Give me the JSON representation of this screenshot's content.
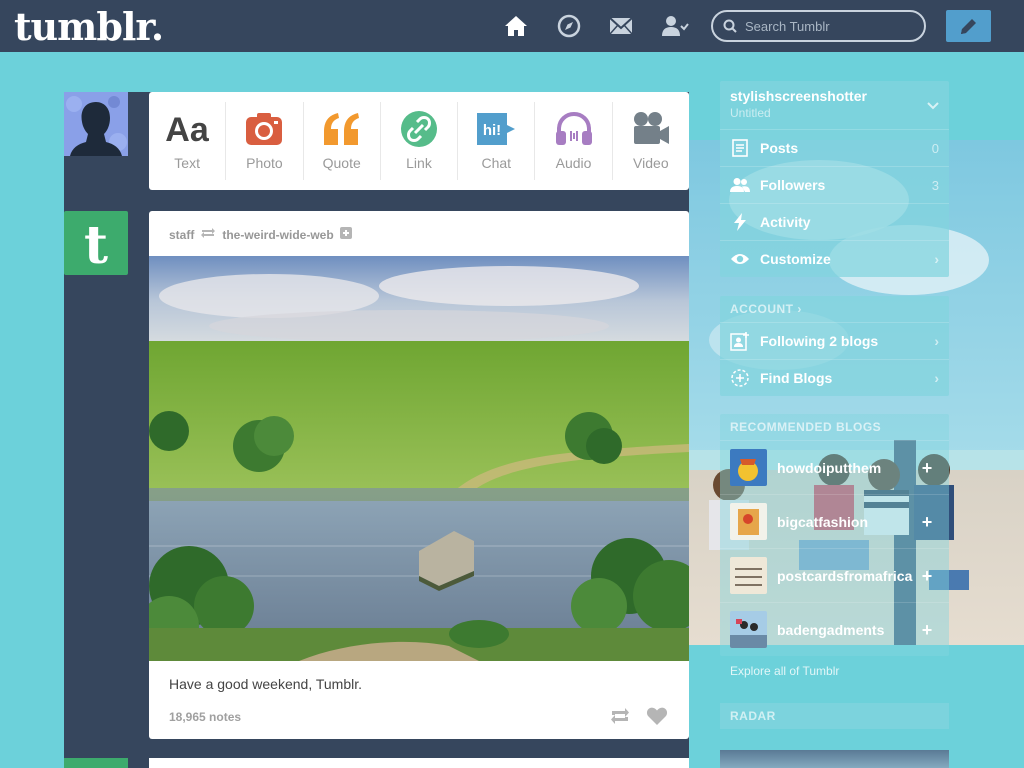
{
  "header": {
    "logo": "tumblr.",
    "search_placeholder": "Search Tumblr",
    "nav": [
      "home-icon",
      "explore-icon",
      "inbox-icon",
      "account-icon"
    ],
    "compose_icon": "pencil-icon"
  },
  "post_types": [
    {
      "label": "Text",
      "icon": "text-icon",
      "color": "#444444"
    },
    {
      "label": "Photo",
      "icon": "camera-icon",
      "color": "#d95e40"
    },
    {
      "label": "Quote",
      "icon": "quote-icon",
      "color": "#f2992e"
    },
    {
      "label": "Link",
      "icon": "link-icon",
      "color": "#56bc8a"
    },
    {
      "label": "Chat",
      "icon": "chat-icon",
      "color": "#529ecc"
    },
    {
      "label": "Audio",
      "icon": "headphones-icon",
      "color": "#a77dc2"
    },
    {
      "label": "Video",
      "icon": "video-camera-icon",
      "color": "#748089"
    }
  ],
  "post": {
    "author": "staff",
    "reblogged_from": "the-weird-wide-web",
    "caption": "Have a good weekend, Tumblr.",
    "notes": "18,965 notes"
  },
  "sidebar": {
    "blog_name": "stylishscreenshotter",
    "blog_title": "Untitled",
    "menu": [
      {
        "label": "Posts",
        "icon": "posts-icon",
        "count": "0"
      },
      {
        "label": "Followers",
        "icon": "followers-icon",
        "count": "3"
      },
      {
        "label": "Activity",
        "icon": "activity-icon",
        "count": ""
      },
      {
        "label": "Customize",
        "icon": "eye-icon",
        "count": ""
      }
    ],
    "account_header": "ACCOUNT ›",
    "account_items": [
      {
        "label": "Following 2 blogs",
        "icon": "following-icon"
      },
      {
        "label": "Find Blogs",
        "icon": "find-blogs-icon"
      }
    ],
    "recommended_header": "RECOMMENDED BLOGS",
    "recommended": [
      {
        "name": "howdoiputthem",
        "follow": "+"
      },
      {
        "name": "bigcatfashion",
        "follow": "+"
      },
      {
        "name": "postcardsfromafrica",
        "follow": "+"
      },
      {
        "name": "badengadments",
        "follow": "+"
      }
    ],
    "explore": "Explore all of Tumblr",
    "radar_header": "RADAR"
  },
  "colors": {
    "background": "#6cd1da",
    "header": "#36465d",
    "compose": "#529ecc",
    "staff": "#3dab6d"
  }
}
